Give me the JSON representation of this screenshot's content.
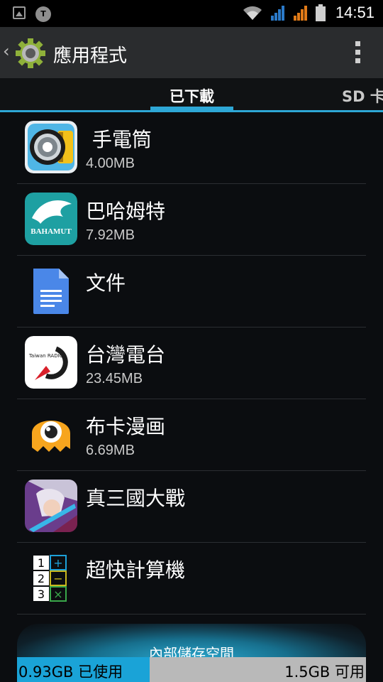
{
  "status_bar": {
    "time": "14:51"
  },
  "action_bar": {
    "title": "應用程式"
  },
  "tabs": [
    {
      "label": "已下載",
      "active": true
    },
    {
      "label": "SD 卡",
      "active": false
    }
  ],
  "apps": [
    {
      "name": " 手電筒",
      "size": "4.00MB",
      "icon": "flashlight-icon"
    },
    {
      "name": "巴哈姆特",
      "size": "7.92MB",
      "icon": "bahamut-icon",
      "icon_text": "BAHAMUT"
    },
    {
      "name": "文件",
      "size": "",
      "icon": "google-docs-icon"
    },
    {
      "name": "台灣電台",
      "size": "23.45MB",
      "icon": "taiwan-radio-icon",
      "icon_text": "Taiwan RADIO"
    },
    {
      "name": "布卡漫画",
      "size": "6.69MB",
      "icon": "buka-manga-icon"
    },
    {
      "name": "真三國大戰",
      "size": "",
      "icon": "game-character-icon"
    },
    {
      "name": "超快計算機",
      "size": "",
      "icon": "calculator-icon"
    }
  ],
  "storage": {
    "title": "內部儲存空間",
    "used": "0.93GB 已使用",
    "free": "1.5GB 可用",
    "used_fraction": 0.38
  },
  "colors": {
    "accent": "#2ea7d6",
    "bar_used": "#1aa3d7",
    "bar_free": "#b9b9b9"
  }
}
